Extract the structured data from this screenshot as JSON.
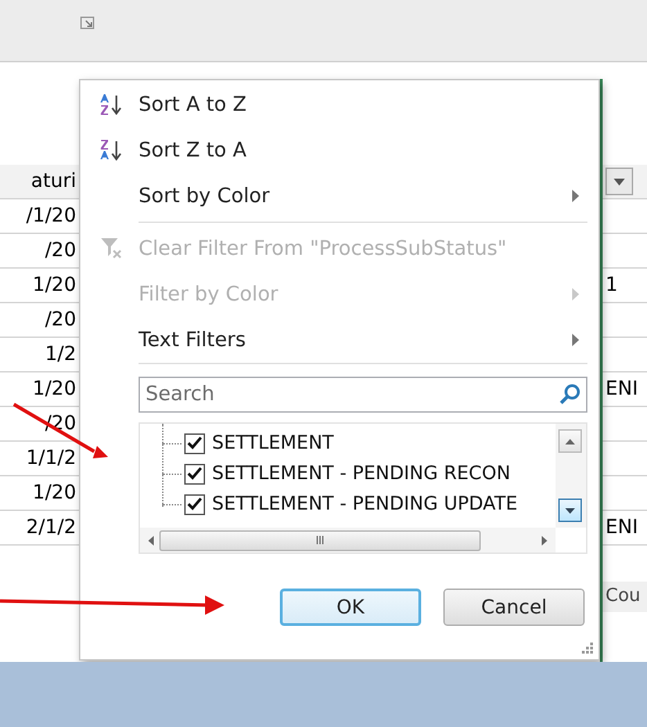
{
  "sheet": {
    "left_header": "aturi",
    "left_cells": [
      "/1/20",
      "/20",
      "1/20",
      "/20",
      "1/2",
      "1/20",
      "/20",
      "1/1/2",
      "1/20",
      "2/1/2"
    ],
    "right_cells": [
      {},
      {},
      {
        "text": "1"
      },
      {},
      {},
      {
        "text": "ENI"
      },
      {},
      {},
      {},
      {
        "text": "ENI"
      }
    ],
    "status_text": "Cou"
  },
  "menu": {
    "items": [
      {
        "kind": "sort-asc",
        "label": "Sort A to Z",
        "disabled": false,
        "submenu": false
      },
      {
        "kind": "sort-desc",
        "label": "Sort Z to A",
        "disabled": false,
        "submenu": false
      },
      {
        "kind": "plain",
        "label": "Sort by Color",
        "disabled": false,
        "submenu": true
      },
      {
        "kind": "separator"
      },
      {
        "kind": "clear-filter",
        "label": "Clear Filter From \"ProcessSubStatus\"",
        "disabled": true,
        "submenu": false
      },
      {
        "kind": "plain",
        "label": "Filter by Color",
        "disabled": true,
        "submenu": true
      },
      {
        "kind": "plain",
        "label": "Text Filters",
        "disabled": false,
        "submenu": true
      }
    ],
    "search": {
      "placeholder": "Search"
    },
    "values": [
      {
        "label": "SETTLEMENT",
        "checked": true
      },
      {
        "label": "SETTLEMENT - PENDING RECON",
        "checked": true
      },
      {
        "label": "SETTLEMENT - PENDING UPDATE",
        "checked": true
      }
    ],
    "buttons": [
      {
        "label": "OK",
        "focused": true
      },
      {
        "label": "Cancel",
        "focused": false
      }
    ]
  }
}
